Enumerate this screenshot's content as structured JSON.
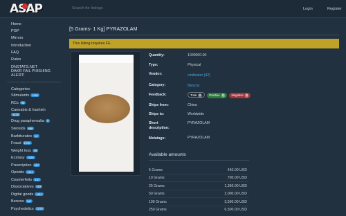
{
  "header": {
    "logo_text": "ASAP",
    "search_placeholder": "Search for listings",
    "login": "Login",
    "register": "Register"
  },
  "sidebar": {
    "links": [
      "Home",
      "PGP",
      "Mirrors",
      "Introduction",
      "FAQ",
      "Rules",
      "DNSTATS.NET",
      "DAKR FAIL PHISHING",
      "ALERT!"
    ],
    "categories_title": "Categories",
    "categories": [
      {
        "name": "Stimulants",
        "count": "1262"
      },
      {
        "name": "RCs",
        "count": "96"
      },
      {
        "name": "Cannabis & hashish",
        "count": "1425"
      },
      {
        "name": "Drug paraphernalia",
        "count": "9"
      },
      {
        "name": "Steroids",
        "count": "480"
      },
      {
        "name": "Barbiturates",
        "count": "12"
      },
      {
        "name": "Fraud",
        "count": "1209"
      },
      {
        "name": "Weight loss",
        "count": "29"
      },
      {
        "name": "Ecstasy",
        "count": "1025"
      },
      {
        "name": "Prescription",
        "count": "457"
      },
      {
        "name": "Opioids",
        "count": "1411"
      },
      {
        "name": "Counterfeits",
        "count": "110"
      },
      {
        "name": "Dissociatives",
        "count": "197"
      },
      {
        "name": "Digital goods",
        "count": "1817"
      },
      {
        "name": "Benzos",
        "count": "247"
      },
      {
        "name": "Psychedelics",
        "count": "1079"
      }
    ]
  },
  "listing": {
    "title": "[5 Grams- 1 Kg] PYRAZOLAM",
    "alert": "This listing requires FE",
    "fields": {
      "quantity_label": "Quantity:",
      "quantity": "1000000.00",
      "type_label": "Type:",
      "type": "Physical",
      "vendor_label": "Vendor:",
      "vendor": "cindicator (42)",
      "category_label": "Category:",
      "category": "Benzos",
      "feedback_label": "Feedback:",
      "ships_from_label": "Ships from:",
      "ships_from": "China",
      "ships_to_label": "Ships to:",
      "ships_to": "Worldwide",
      "short_desc_label_1": "Short",
      "short_desc_label_2": "description:",
      "short_desc": "PYRAZOLAM",
      "metatags_label": "Metatags:",
      "metatags": "PYRAZOLAM"
    },
    "feedback": {
      "total_label": "Total",
      "total_count": "0",
      "positive_label": "Positive",
      "positive_count": "0",
      "negative_label": "Negative",
      "negative_count": "0"
    }
  },
  "amounts": {
    "title": "Available amounts",
    "rows": [
      {
        "qty": "5 Grams",
        "price": "450.00 USD"
      },
      {
        "qty": "10 Grams",
        "price": "700.00 USD"
      },
      {
        "qty": "25 Grams",
        "price": "1,350.00 USD"
      },
      {
        "qty": "50 Grams",
        "price": "2,000.00 USD"
      },
      {
        "qty": "100 Grams",
        "price": "3,500.00 USD"
      },
      {
        "qty": "250 Grams",
        "price": "6,500.00 USD"
      }
    ]
  }
}
